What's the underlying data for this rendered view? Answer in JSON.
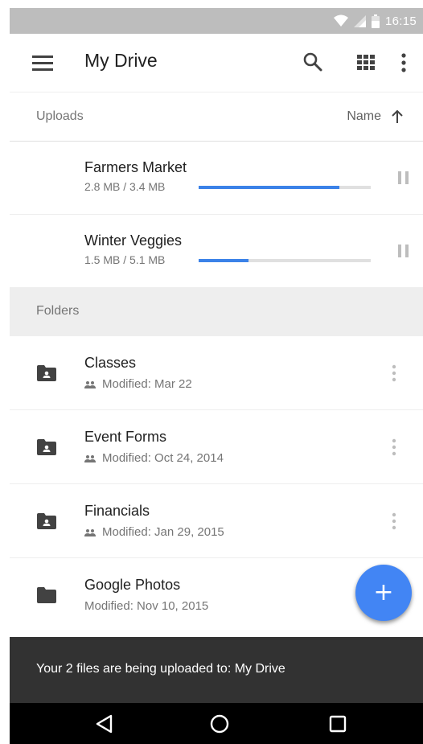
{
  "status_bar": {
    "time": "16:15",
    "icons": [
      "wifi-icon",
      "signal-icon",
      "battery-icon"
    ]
  },
  "app_bar": {
    "title": "My Drive",
    "icons": [
      "menu-icon",
      "search-icon",
      "grid-view-icon",
      "more-vert-icon"
    ]
  },
  "uploads": {
    "section_label": "Uploads",
    "sort_label": "Name",
    "sort_icon": "arrow-up-icon",
    "items": [
      {
        "name": "Farmers Market",
        "size": "2.8 MB / 3.4 MB",
        "progress": 0.82
      },
      {
        "name": "Winter Veggies",
        "size": "1.5 MB / 5.1 MB",
        "progress": 0.29
      }
    ]
  },
  "folders": {
    "section_label": "Folders",
    "items": [
      {
        "name": "Classes",
        "modified": "Modified: Mar 22",
        "shared": true
      },
      {
        "name": "Event Forms",
        "modified": "Modified: Oct 24, 2014",
        "shared": true
      },
      {
        "name": "Financials",
        "modified": "Modified: Jan 29, 2015",
        "shared": true
      },
      {
        "name": "Google Photos",
        "modified": "Modified: Nov 10, 2015",
        "shared": false
      }
    ]
  },
  "fab": {
    "label": "+"
  },
  "snackbar": {
    "text": "Your 2 files are being uploaded to: My Drive"
  },
  "nav_bar": {
    "icons": [
      "back-icon",
      "home-icon",
      "recents-icon"
    ]
  },
  "colors": {
    "accent": "#4285f4",
    "progress": "#3b82e8",
    "status_bar": "#bdbdbd",
    "snackbar": "#323232"
  }
}
